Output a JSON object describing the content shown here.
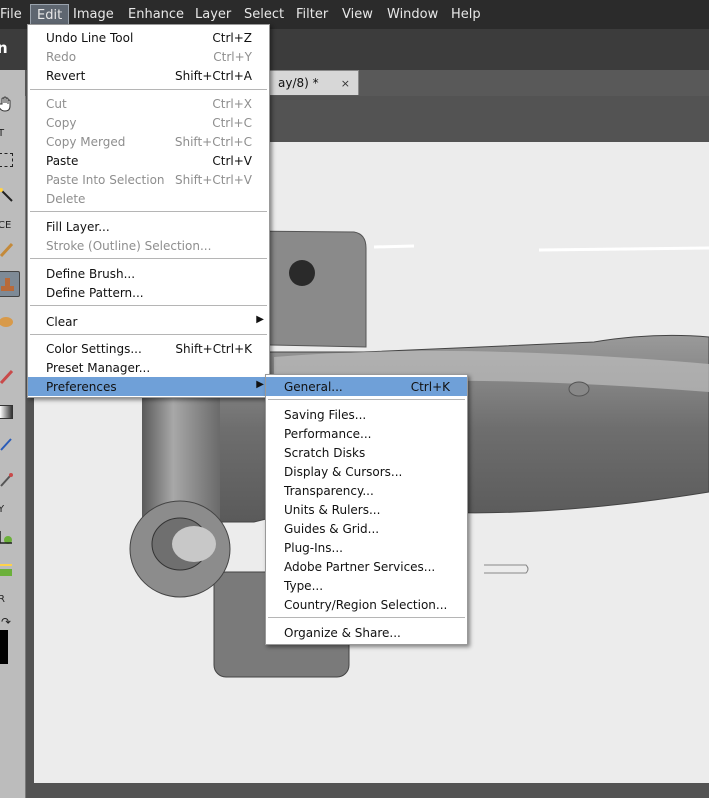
{
  "menubar": {
    "items": [
      "File",
      "Edit",
      "Image",
      "Enhance",
      "Layer",
      "Select",
      "Filter",
      "View",
      "Window",
      "Help"
    ],
    "active": "Edit"
  },
  "options": {
    "logo_text": "n"
  },
  "toolbox": {
    "sections": [
      "T",
      "CE",
      "Y",
      "R"
    ]
  },
  "tab": {
    "title": "ay/8) *",
    "close": "×"
  },
  "edit_menu": {
    "items": [
      {
        "label": "Undo Line Tool",
        "shortcut": "Ctrl+Z",
        "enabled": true
      },
      {
        "label": "Redo",
        "shortcut": "Ctrl+Y",
        "enabled": false
      },
      {
        "label": "Revert",
        "shortcut": "Shift+Ctrl+A",
        "enabled": true
      },
      {
        "label": "Cut",
        "shortcut": "Ctrl+X",
        "enabled": false
      },
      {
        "label": "Copy",
        "shortcut": "Ctrl+C",
        "enabled": false
      },
      {
        "label": "Copy Merged",
        "shortcut": "Shift+Ctrl+C",
        "enabled": false
      },
      {
        "label": "Paste",
        "shortcut": "Ctrl+V",
        "enabled": true
      },
      {
        "label": "Paste Into Selection",
        "shortcut": "Shift+Ctrl+V",
        "enabled": false
      },
      {
        "label": "Delete",
        "shortcut": "",
        "enabled": false
      },
      {
        "label": "Fill Layer...",
        "shortcut": "",
        "enabled": true
      },
      {
        "label": "Stroke (Outline) Selection...",
        "shortcut": "",
        "enabled": false
      },
      {
        "label": "Define Brush...",
        "shortcut": "",
        "enabled": true
      },
      {
        "label": "Define Pattern...",
        "shortcut": "",
        "enabled": true
      },
      {
        "label": "Clear",
        "shortcut": "",
        "enabled": true
      },
      {
        "label": "Color Settings...",
        "shortcut": "Shift+Ctrl+K",
        "enabled": true
      },
      {
        "label": "Preset Manager...",
        "shortcut": "",
        "enabled": true
      },
      {
        "label": "Preferences",
        "shortcut": "",
        "enabled": true
      }
    ]
  },
  "preferences_menu": {
    "items": [
      {
        "label": "General...",
        "shortcut": "Ctrl+K"
      },
      {
        "label": "Saving Files...",
        "shortcut": ""
      },
      {
        "label": "Performance...",
        "shortcut": ""
      },
      {
        "label": "Scratch Disks",
        "shortcut": ""
      },
      {
        "label": "Display & Cursors...",
        "shortcut": ""
      },
      {
        "label": "Transparency...",
        "shortcut": ""
      },
      {
        "label": "Units & Rulers...",
        "shortcut": ""
      },
      {
        "label": "Guides & Grid...",
        "shortcut": ""
      },
      {
        "label": "Plug-Ins...",
        "shortcut": ""
      },
      {
        "label": "Adobe Partner Services...",
        "shortcut": ""
      },
      {
        "label": "Type...",
        "shortcut": ""
      },
      {
        "label": "Country/Region Selection...",
        "shortcut": ""
      },
      {
        "label": "Organize & Share...",
        "shortcut": ""
      }
    ]
  },
  "colors": {
    "highlight": "#6fa0d8",
    "menubar": "#2b2b2b",
    "canvas": "#ececec"
  }
}
